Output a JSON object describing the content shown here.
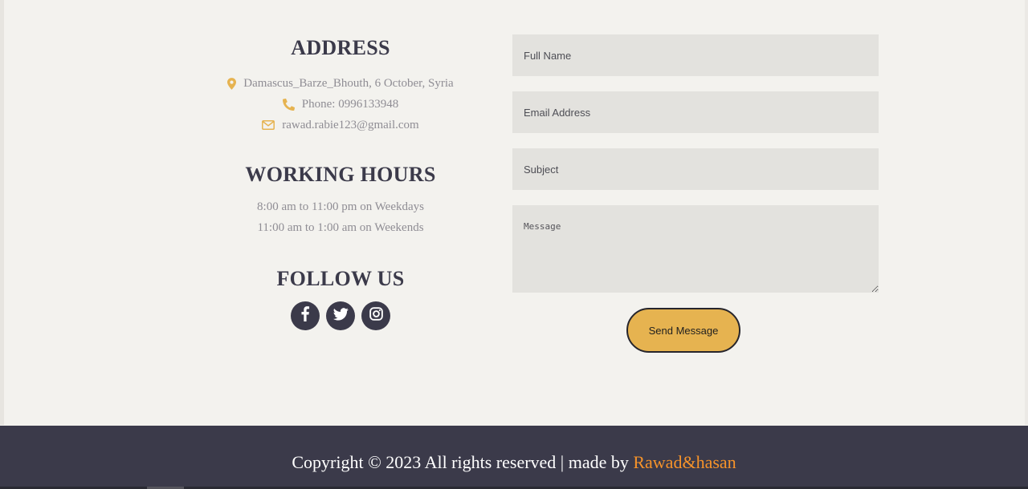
{
  "colors": {
    "accent": "#e6b350",
    "dark": "#3b3a4a",
    "background": "#f3f2ee",
    "field_background": "#e3e2de",
    "footer_link": "#f6932a"
  },
  "address": {
    "title": "ADDRESS",
    "location": {
      "icon": "map-pin-icon",
      "text": "Damascus_Barze_Bhouth, 6 October, Syria"
    },
    "phone": {
      "icon": "phone-icon",
      "text": "Phone: 0996133948"
    },
    "email": {
      "icon": "envelope-icon",
      "text": "rawad.rabie123@gmail.com"
    }
  },
  "working_hours": {
    "title": "WORKING HOURS",
    "weekdays": "8:00 am to 11:00 pm on Weekdays",
    "weekends": "11:00 am to 1:00 am on Weekends"
  },
  "follow_us": {
    "title": "FOLLOW US",
    "networks": [
      {
        "icon": "facebook-icon"
      },
      {
        "icon": "twitter-icon"
      },
      {
        "icon": "instagram-icon"
      }
    ]
  },
  "form": {
    "full_name_placeholder": "Full Name",
    "email_placeholder": "Email Address",
    "subject_placeholder": "Subject",
    "message_placeholder": "Message",
    "submit_label": "Send Message"
  },
  "footer": {
    "copyright": "Copyright © 2023 All rights reserved | made by ",
    "author": "Rawad&hasan"
  }
}
